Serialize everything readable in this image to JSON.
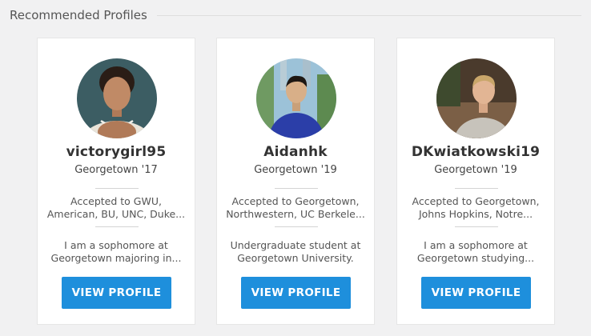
{
  "section": {
    "title": "Recommended Profiles"
  },
  "colors": {
    "button": "#1e8fdc",
    "background": "#f1f1f2",
    "card": "#ffffff"
  },
  "profiles": [
    {
      "username": "victorygirl95",
      "school": "Georgetown '17",
      "accepted": "Accepted to GWU, American, BU, UNC, Duke...",
      "bio": "I am a sophomore at Georgetown majoring in...",
      "button_label": "VIEW PROFILE"
    },
    {
      "username": "Aidanhk",
      "school": "Georgetown '19",
      "accepted": "Accepted to Georgetown, Northwestern, UC Berkele...",
      "bio": "Undergraduate student at Georgetown University.",
      "button_label": "VIEW PROFILE"
    },
    {
      "username": "DKwiatkowski19",
      "school": "Georgetown '19",
      "accepted": "Accepted to Georgetown, Johns Hopkins, Notre...",
      "bio": "I am a sophomore at Georgetown studying...",
      "button_label": "VIEW PROFILE"
    }
  ]
}
